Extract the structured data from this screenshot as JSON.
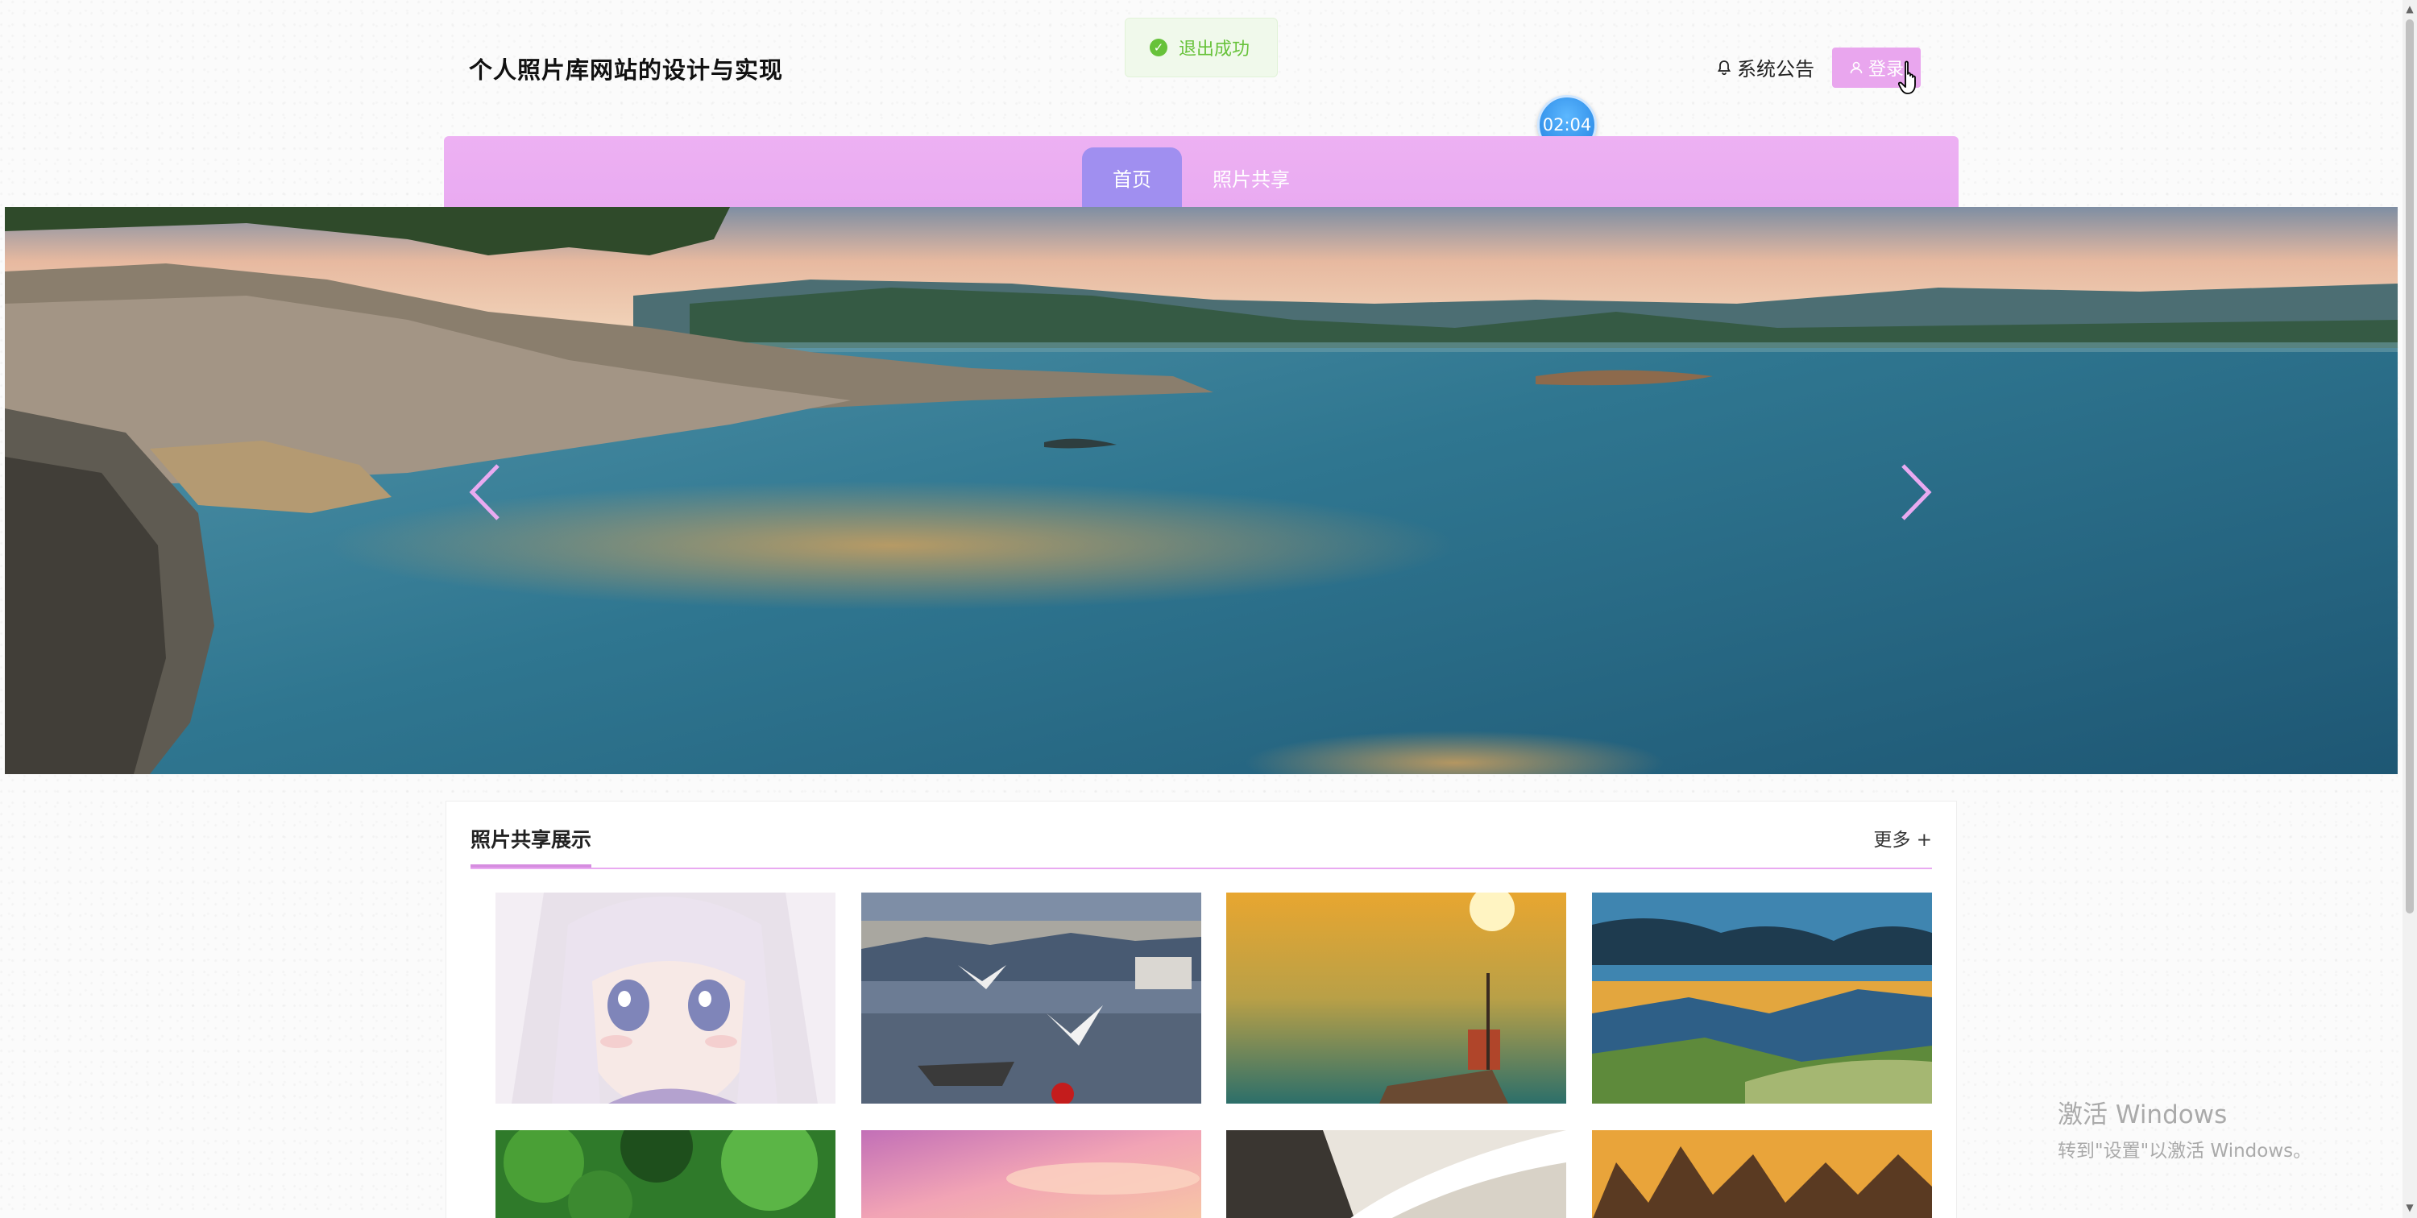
{
  "header": {
    "site_title": "个人照片库网站的设计与实现",
    "announcement_label": "系统公告",
    "login_label": "登录"
  },
  "toast": {
    "message": "退出成功",
    "type": "success",
    "color": "#67c23a"
  },
  "timer": {
    "text": "02:04"
  },
  "nav": {
    "items": [
      {
        "label": "首页",
        "active": true
      },
      {
        "label": "照片共享",
        "active": false
      }
    ],
    "bar_color": "#e9aaf1",
    "active_color": "#a08ff0"
  },
  "banner": {
    "prev_icon": "chevron-left-icon",
    "next_icon": "chevron-right-icon"
  },
  "gallery": {
    "title": "照片共享展示",
    "more_label": "更多 +",
    "photos": [
      {
        "subject": "anime-girl"
      },
      {
        "subject": "seagulls-boat"
      },
      {
        "subject": "sunset-sea-boat"
      },
      {
        "subject": "mountain-sunset"
      },
      {
        "subject": "green-forest"
      },
      {
        "subject": "pink-sky"
      },
      {
        "subject": "beach-waves"
      },
      {
        "subject": "golden-peaks"
      }
    ]
  },
  "watermark": {
    "line1": "激活 Windows",
    "line2": "转到\"设置\"以激活 Windows。"
  }
}
